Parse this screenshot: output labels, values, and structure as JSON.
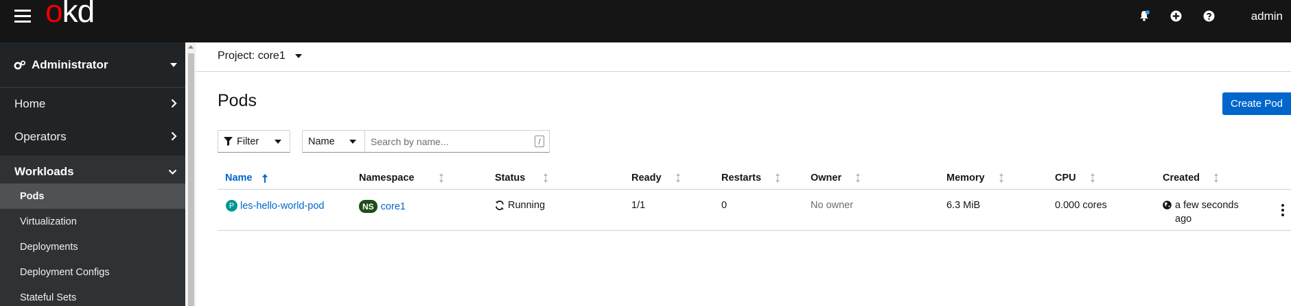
{
  "masthead": {
    "logo_o": "o",
    "logo_kd": "kd",
    "user": "admin",
    "icons": [
      "notifications-icon",
      "plus-circle-icon",
      "help-icon"
    ]
  },
  "sidebar": {
    "perspective": "Administrator",
    "items": [
      {
        "label": "Home"
      },
      {
        "label": "Operators"
      },
      {
        "label": "Workloads"
      }
    ],
    "workloads_sub": [
      {
        "label": "Pods"
      },
      {
        "label": "Virtualization"
      },
      {
        "label": "Deployments"
      },
      {
        "label": "Deployment Configs"
      },
      {
        "label": "Stateful Sets"
      }
    ]
  },
  "main": {
    "project_label": "Project: core1",
    "title": "Pods",
    "create_button": "Create Pod",
    "filter_label": "Filter",
    "name_select": "Name",
    "search_placeholder": "Search by name...",
    "search_hint": "/"
  },
  "table": {
    "columns": [
      "Name",
      "Namespace",
      "Status",
      "Ready",
      "Restarts",
      "Owner",
      "Memory",
      "CPU",
      "Created"
    ],
    "rows": [
      {
        "name_badge": "P",
        "name": "les-hello-world-pod",
        "namespace_badge": "NS",
        "namespace": "core1",
        "status": "Running",
        "ready": "1/1",
        "restarts": "0",
        "owner": "No owner",
        "memory": "6.3 MiB",
        "cpu": "0.000 cores",
        "created_line1": "a few seconds",
        "created_line2": "ago"
      }
    ]
  },
  "colors": {
    "accent": "#0066cc",
    "masthead_bg": "#151515",
    "sidebar_bg": "#212427",
    "pod_badge": "#009596",
    "ns_badge": "#1e4f18",
    "logo_red": "#ee0000"
  }
}
